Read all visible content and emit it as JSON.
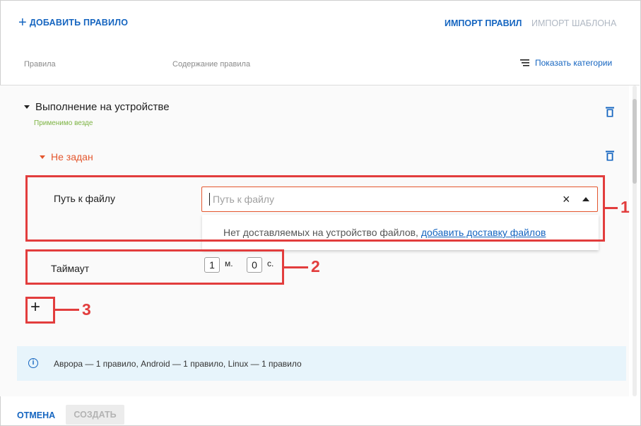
{
  "toolbar": {
    "add_rule_icon": "+",
    "add_rule_label": "ДОБАВИТЬ ПРАВИЛО",
    "import_rules_label": "ИМПОРТ ПРАВИЛ",
    "import_template_label": "ИМПОРТ ШАБЛОНА"
  },
  "columns": {
    "rules": "Правила",
    "content": "Содержание правила",
    "show_categories": "Показать категории"
  },
  "rule_group": {
    "title": "Выполнение на устройстве",
    "applies": "Применимо везде",
    "sub_rule": {
      "title": "Не задан",
      "file_path_label": "Путь к файлу",
      "file_path_placeholder": "Путь к файлу",
      "file_path_value": "",
      "clear_icon": "×",
      "dropdown_message": "Нет доставляемых на устройство файлов,",
      "dropdown_link": "добавить доставку файлов",
      "timeout_label": "Таймаут",
      "timeout_minutes": "1",
      "minutes_unit": "м.",
      "timeout_seconds": "0",
      "seconds_unit": "с."
    },
    "add_condition_icon": "+"
  },
  "annotations": [
    "1",
    "2",
    "3"
  ],
  "info": {
    "icon": "i",
    "text": "Аврора — 1 правило, Android — 1 правило, Linux — 1 правило"
  },
  "footer": {
    "cancel_label": "ОТМЕНА",
    "create_label": "СОЗДАТЬ"
  },
  "colors": {
    "accent": "#1565c0",
    "error": "#e4572e",
    "success": "#7cb342",
    "annotation": "#e23d3d",
    "info_bg": "#e7f4fb"
  },
  "icons": {
    "trash": "trash-icon",
    "menu": "list-icon",
    "info": "info-icon"
  }
}
